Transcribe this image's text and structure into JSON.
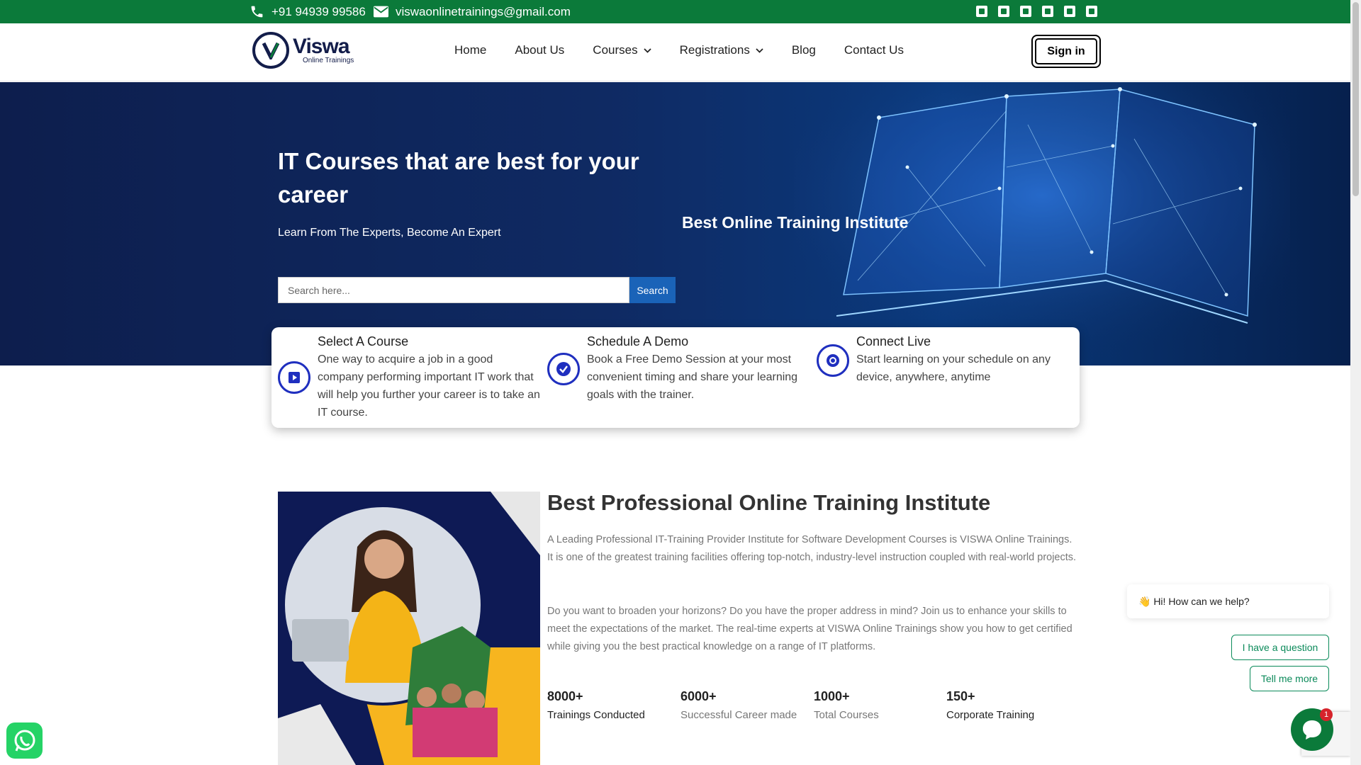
{
  "topbar": {
    "phone": "+91 94939 99586",
    "email": "viswaonlinetrainings@gmail.com",
    "socials": [
      "facebook-icon",
      "twitter-icon",
      "youtube-icon",
      "instagram-icon",
      "pinterest-icon",
      "linkedin-icon"
    ]
  },
  "header": {
    "logo_name": "Viswa",
    "logo_tagline": "Online Trainings",
    "nav": [
      "Home",
      "About Us",
      "Courses",
      "Registrations",
      "Blog",
      "Contact Us"
    ],
    "signin": "Sign in"
  },
  "hero": {
    "title": "IT Courses that are best for your career",
    "subtitle": "Learn From The Experts, Become An Expert",
    "tagline": "Best Online Training Institute",
    "search_placeholder": "Search here...",
    "search_button": "Search"
  },
  "features": [
    {
      "title": "Select A Course",
      "desc": "One way to acquire a job in a good company performing important IT work that will help you further your career is to take an IT course.",
      "icon": "play-icon"
    },
    {
      "title": "Schedule A Demo",
      "desc": "Book a Free Demo Session at your most convenient timing and share your learning goals with the trainer.",
      "icon": "check-icon"
    },
    {
      "title": "Connect Live",
      "desc": "Start learning on your schedule on any device, anywhere, anytime",
      "icon": "target-icon"
    }
  ],
  "about": {
    "title": "Best Professional Online Training Institute",
    "p1": "A Leading Professional IT-Training Provider Institute for Software Development Courses is VISWA Online Trainings. It is one of the greatest training facilities offering top-notch, industry-level instruction coupled with real-world projects.",
    "p2": "Do you want to broaden your horizons? Do you have the proper address in mind? Join us to enhance your skills to meet the expectations of the market. The real-time experts at VISWA Online Trainings show you how to get certified while giving you the best practical knowledge on a range of IT platforms.",
    "stats": [
      {
        "num": "8000+",
        "label": "Trainings Conducted"
      },
      {
        "num": "6000+",
        "label": "Successful Career made"
      },
      {
        "num": "1000+",
        "label": "Total Courses"
      },
      {
        "num": "150+",
        "label": "Corporate Training"
      }
    ]
  },
  "chat": {
    "greeting": "👋 Hi! How can we help?",
    "btn1": "I have a question",
    "btn2": "Tell me more",
    "badge": "1"
  },
  "colors": {
    "topbar": "#0b7a3a",
    "hero_bg": "#0f2a63",
    "accent_blue": "#1f2fbf",
    "search_button": "#1a63b8"
  }
}
